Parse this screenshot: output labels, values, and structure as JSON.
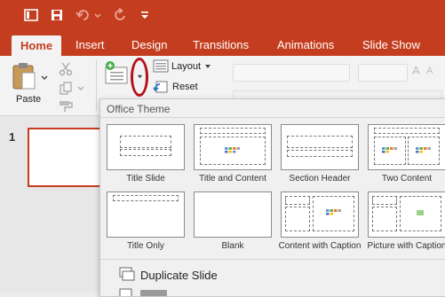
{
  "tabs": [
    "Home",
    "Insert",
    "Design",
    "Transitions",
    "Animations",
    "Slide Show"
  ],
  "ribbon": {
    "paste_label": "Paste",
    "layout_label": "Layout",
    "reset_label": "Reset"
  },
  "slide_panel": {
    "slide_number": "1"
  },
  "layout_menu": {
    "header": "Office Theme",
    "layouts": [
      "Title Slide",
      "Title and Content",
      "Section Header",
      "Two Content",
      "Title Only",
      "Blank",
      "Content with Caption",
      "Picture with Caption"
    ],
    "duplicate_label": "Duplicate Slide"
  },
  "colors": {
    "accent": "#c43d1f",
    "highlight_ring": "#b5121b"
  }
}
